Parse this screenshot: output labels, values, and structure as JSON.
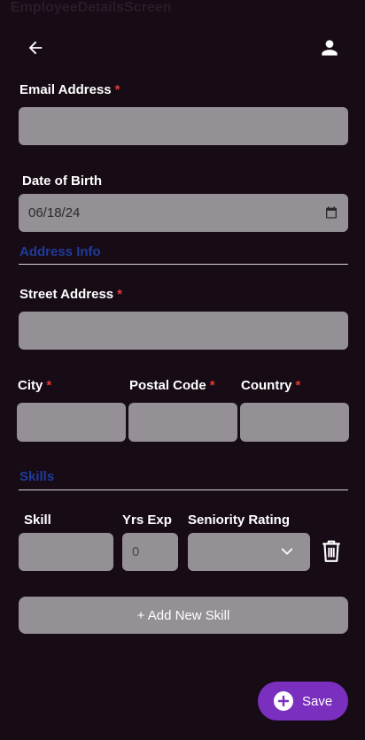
{
  "screen": {
    "title": "EmployeeDetailsScreen"
  },
  "header": {
    "back_icon": "arrow-left-icon",
    "profile_icon": "person-icon"
  },
  "form": {
    "email": {
      "label": "Email Address",
      "required_mark": "*",
      "value": ""
    },
    "dob": {
      "label": "Date of Birth",
      "value": "06/18/24",
      "icon": "calendar-icon"
    },
    "address_section": {
      "title": "Address Info"
    },
    "street": {
      "label": "Street Address",
      "required_mark": "*",
      "value": ""
    },
    "city": {
      "label": "City",
      "required_mark": "*",
      "value": ""
    },
    "postal": {
      "label": "Postal Code",
      "required_mark": "*",
      "value": ""
    },
    "country": {
      "label": "Country",
      "required_mark": "*",
      "value": ""
    },
    "skills_section": {
      "title": "Skills"
    },
    "skill_row": {
      "skill_label": "Skill",
      "yrs_label": "Yrs Exp",
      "yrs_value": "0",
      "seniority_label": "Seniority Rating",
      "seniority_value": "",
      "dropdown_icon": "chevron-down-icon",
      "delete_icon": "trash-icon"
    },
    "add_skill_label": "+ Add New Skill"
  },
  "footer": {
    "save_label": "Save",
    "save_icon": "plus-circle-icon"
  },
  "colors": {
    "background": "#170b16",
    "field": "#949096",
    "required": "#e53935",
    "section_title": "#1f3b9a",
    "save_button": "#7b2fbe"
  }
}
